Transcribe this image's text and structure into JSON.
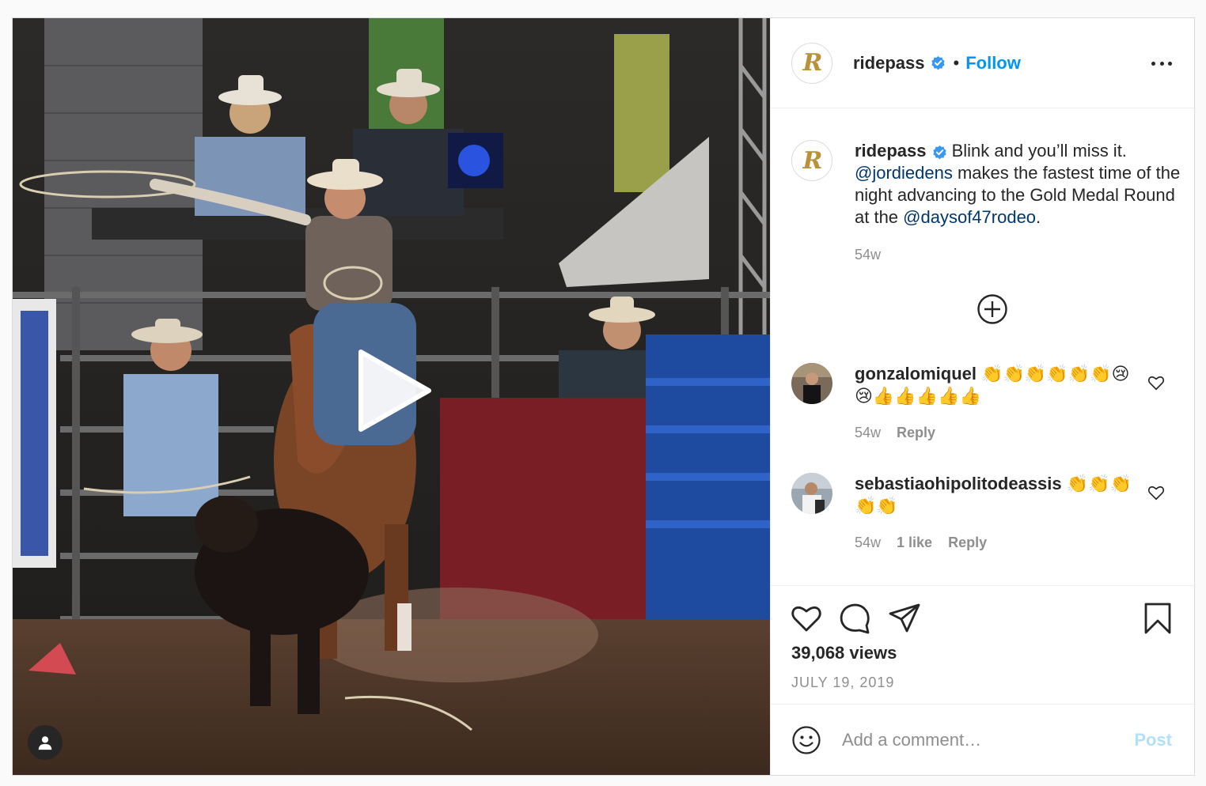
{
  "post": {
    "media": {
      "type": "video",
      "description_icons": [
        "play-icon",
        "user-tag-icon"
      ]
    },
    "header": {
      "username": "ridepass",
      "avatar_initial": "R",
      "separator": "•",
      "follow_label": "Follow",
      "more_icon": "more-options-icon"
    },
    "caption": {
      "username": "ridepass",
      "text_before": " Blink and you’ll miss it. ",
      "mention_1": "@jordiedens",
      "text_middle": " makes the fastest time of the night advancing to the Gold Medal Round at the ",
      "mention_2": "@daysof47rodeo",
      "text_after": ".",
      "time": "54w"
    },
    "load_more_icon": "plus-circle-icon",
    "comments": [
      {
        "username": "gonzalomiquel",
        "text": " 👏👏👏👏👏👏😢😢👍👍👍👍👍",
        "time": "54w",
        "likes": "",
        "reply_label": "Reply"
      },
      {
        "username": "sebastiaohipolitodeassis",
        "text": " 👏👏👏👏👏",
        "time": "54w",
        "likes": "1 like",
        "reply_label": "Reply"
      }
    ],
    "stats": {
      "views": "39,068 views",
      "date": "JULY 19, 2019"
    },
    "add_comment": {
      "placeholder": "Add a comment…",
      "post_label": "Post"
    },
    "colors": {
      "link_blue": "#0095f6",
      "mention_blue": "#00376b",
      "secondary_text": "#8e8e8e",
      "post_disabled": "#b2dffc",
      "brand_gold": "#b8913a"
    }
  }
}
